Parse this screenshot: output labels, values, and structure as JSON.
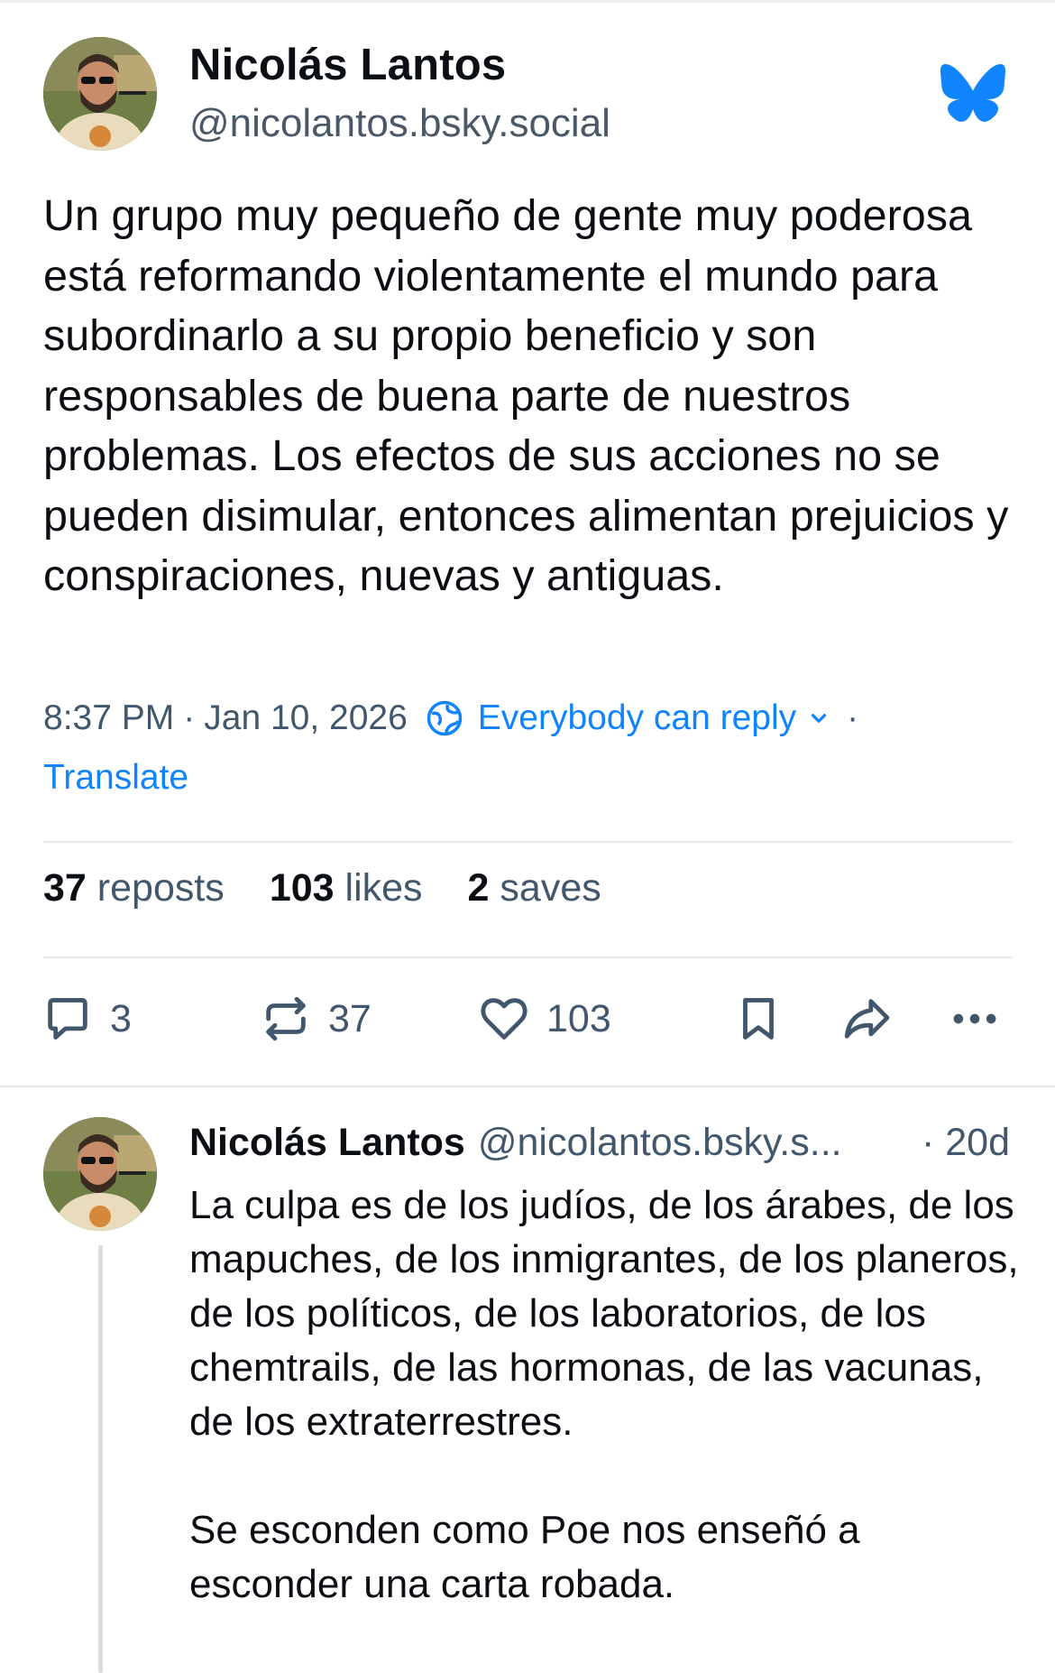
{
  "post": {
    "author_name": "Nicolás Lantos",
    "author_handle": "@nicolantos.bsky.social",
    "text": "Un grupo muy pequeño de gente muy poderosa está reformando violentamente el mundo para subordinarlo a su propio beneficio y son responsables de buena parte de nuestros problemas. Los efectos de sus acciones no se pueden disimular, entonces alimentan prejuicios y conspiraciones, nuevas y antiguas.",
    "time": "8:37 PM",
    "date": "Jan 10, 2026",
    "separator": "·",
    "reply_setting": "Everybody can reply",
    "translate": "Translate"
  },
  "stats": {
    "reposts_count": "37",
    "reposts_label": "reposts",
    "likes_count": "103",
    "likes_label": "likes",
    "saves_count": "2",
    "saves_label": "saves"
  },
  "actions": {
    "reply_count": "3",
    "repost_count": "37",
    "like_count": "103"
  },
  "reply": {
    "author_name": "Nicolás Lantos",
    "author_handle": "@nicolantos.bsky.s...",
    "time": "· 20d",
    "paragraph_1": "La culpa es de los judíos, de los árabes, de los mapuches, de los inmigrantes, de los planeros, de los políticos, de los laboratorios, de los chemtrails, de las hormonas, de las vacunas, de los extraterrestres.",
    "paragraph_2": "Se esconden como Poe nos enseñó a esconder una carta robada."
  },
  "colors": {
    "accent": "#1083fe",
    "text": "#0b0f14",
    "muted": "#42576c",
    "divider": "#e6eaee"
  },
  "icons": {
    "logo": "bluesky-butterfly-icon",
    "reply": "speech-bubble-icon",
    "repost": "repost-arrows-icon",
    "like": "heart-icon",
    "bookmark": "bookmark-icon",
    "share": "share-arrow-icon",
    "more": "ellipsis-icon",
    "reply_setting": "globe-icon"
  }
}
